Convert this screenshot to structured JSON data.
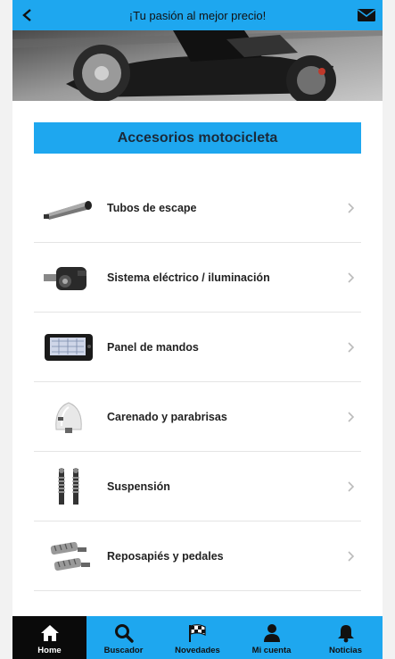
{
  "topbar": {
    "title": "¡Tu pasión al mejor precio!",
    "back_icon": "chevron-left-icon",
    "mail_icon": "envelope-icon"
  },
  "section": {
    "title": "Accesorios motocicleta"
  },
  "categories": [
    {
      "label": "Tubos de escape",
      "icon": "exhaust-pipe-icon"
    },
    {
      "label": "Sistema eléctrico / iluminación",
      "icon": "electrical-system-icon"
    },
    {
      "label": "Panel de mandos",
      "icon": "dashboard-panel-icon"
    },
    {
      "label": "Carenado y parabrisas",
      "icon": "windshield-icon"
    },
    {
      "label": "Suspensión",
      "icon": "suspension-icon"
    },
    {
      "label": "Reposapiés y pedales",
      "icon": "footpeg-icon"
    }
  ],
  "bottomnav": {
    "tabs": [
      {
        "label": "Home",
        "icon": "home-icon",
        "active": true
      },
      {
        "label": "Buscador",
        "icon": "search-icon",
        "active": false
      },
      {
        "label": "Novedades",
        "icon": "checkered-flag-icon",
        "active": false
      },
      {
        "label": "Mi cuenta",
        "icon": "user-icon",
        "active": false
      },
      {
        "label": "Noticias",
        "icon": "bell-icon",
        "active": false
      }
    ]
  },
  "colors": {
    "accent": "#1ea7ef",
    "active_tab": "#0a0a0a"
  }
}
